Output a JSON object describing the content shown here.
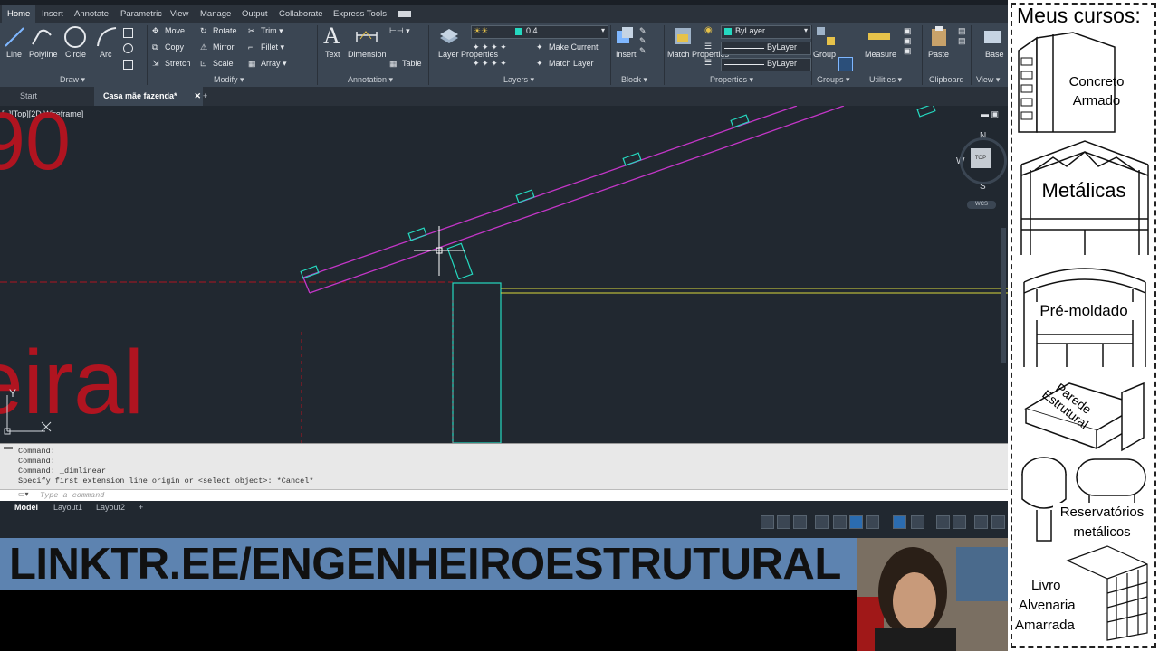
{
  "menu": {
    "tabs": [
      "Home",
      "Insert",
      "Annotate",
      "Parametric",
      "View",
      "Manage",
      "Output",
      "Collaborate",
      "Express Tools"
    ]
  },
  "ribbon": {
    "draw": {
      "title": "Draw",
      "line": "Line",
      "polyline": "Polyline",
      "circle": "Circle",
      "arc": "Arc"
    },
    "modify": {
      "title": "Modify",
      "move": "Move",
      "rotate": "Rotate",
      "trim": "Trim",
      "copy": "Copy",
      "mirror": "Mirror",
      "fillet": "Fillet",
      "stretch": "Stretch",
      "scale": "Scale",
      "array": "Array"
    },
    "annotation": {
      "title": "Annotation",
      "text": "Text",
      "dimension": "Dimension",
      "table": "Table"
    },
    "layers": {
      "title": "Layers",
      "layer_properties": "Layer Properties",
      "layer_value": "0.4",
      "make_current": "Make Current",
      "match_layer": "Match Layer"
    },
    "block": {
      "title": "Block",
      "insert": "Insert"
    },
    "properties": {
      "title": "Properties",
      "match_properties": "Match Properties",
      "color": "ByLayer",
      "linetype": "ByLayer",
      "lineweight": "ByLayer"
    },
    "groups": {
      "title": "Groups",
      "group": "Group"
    },
    "utilities": {
      "title": "Utilities",
      "measure": "Measure"
    },
    "clipboard": {
      "title": "Clipboard",
      "paste": "Paste"
    },
    "view": {
      "title": "View",
      "base": "Base"
    }
  },
  "file_tabs": {
    "start": "Start",
    "current": "Casa mãe fazenda*"
  },
  "viewport": {
    "label": "[−][Top][2D Wireframe]",
    "compass": {
      "n": "N",
      "s": "S",
      "w": "W",
      "top": "TOP",
      "wcs": "WCS"
    },
    "text_top": "90",
    "text_bottom": "eiral",
    "ucs_y": "Y"
  },
  "command": {
    "lines": [
      "Command:",
      "Command:",
      "Command: _dimlinear",
      "Specify first extension line origin or <select object>: *Cancel*"
    ],
    "placeholder": "Type a command"
  },
  "layouts": [
    "Model",
    "Layout1",
    "Layout2"
  ],
  "banner": {
    "text": "LINKTR.EE/ENGENHEIROESTRUTURAL"
  },
  "courses": {
    "title": "Meus cursos:",
    "items": [
      {
        "label_1": "Concreto",
        "label_2": "Armado"
      },
      {
        "label_1": "Metálicas"
      },
      {
        "label_1": "Pré-moldado"
      },
      {
        "label_1": "Parede",
        "label_2": "Estrutural"
      },
      {
        "label_1": "Reservatórios",
        "label_2": "metálicos"
      },
      {
        "label_1": "Livro",
        "label_2": "Alvenaria",
        "label_3": "Amarrada"
      }
    ]
  },
  "colors": {
    "accent": "#3b4653",
    "magenta": "#c436c8",
    "red": "#b01420",
    "cyan": "#25d9c0",
    "yellow": "#d9d93b"
  }
}
